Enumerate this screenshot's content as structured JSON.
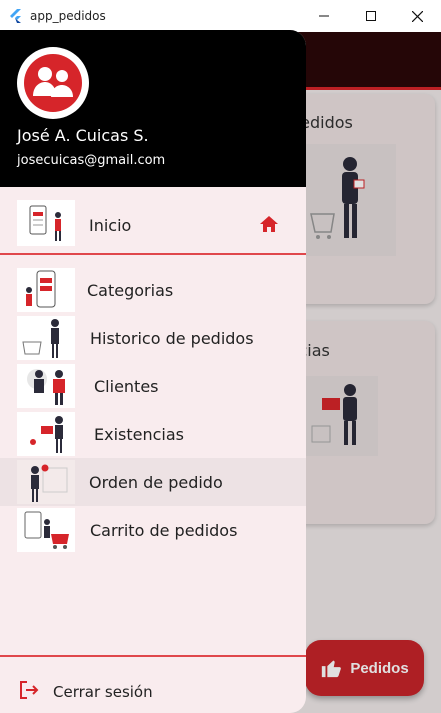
{
  "window": {
    "title": "app_pedidos",
    "app_icon": "flutter-icon",
    "controls": [
      "minimize-icon",
      "maximize-icon",
      "close-icon"
    ]
  },
  "background": {
    "cards": [
      {
        "title": "o de pedidos"
      },
      {
        "title": "xistencias"
      }
    ],
    "fab": {
      "label": "Pedidos",
      "icon": "thumbs-up-icon"
    }
  },
  "drawer": {
    "user": {
      "name": "José A. Cuicas S.",
      "email": "josecuicas@gmail.com",
      "avatar_icon": "users-icon"
    },
    "home": {
      "label": "Inicio",
      "icon": "home-icon"
    },
    "items": [
      {
        "label": "Categorias"
      },
      {
        "label": "Historico de pedidos"
      },
      {
        "label": "Clientes"
      },
      {
        "label": "Existencias"
      },
      {
        "label": "Orden de pedido",
        "active": true
      },
      {
        "label": "Carrito de pedidos"
      }
    ],
    "logout": {
      "label": "Cerrar sesión",
      "icon": "logout-icon"
    }
  },
  "colors": {
    "accent": "#d6252a",
    "header": "#000000",
    "drawer_bg": "#f9ecee",
    "active_item": "#ede2e4"
  }
}
